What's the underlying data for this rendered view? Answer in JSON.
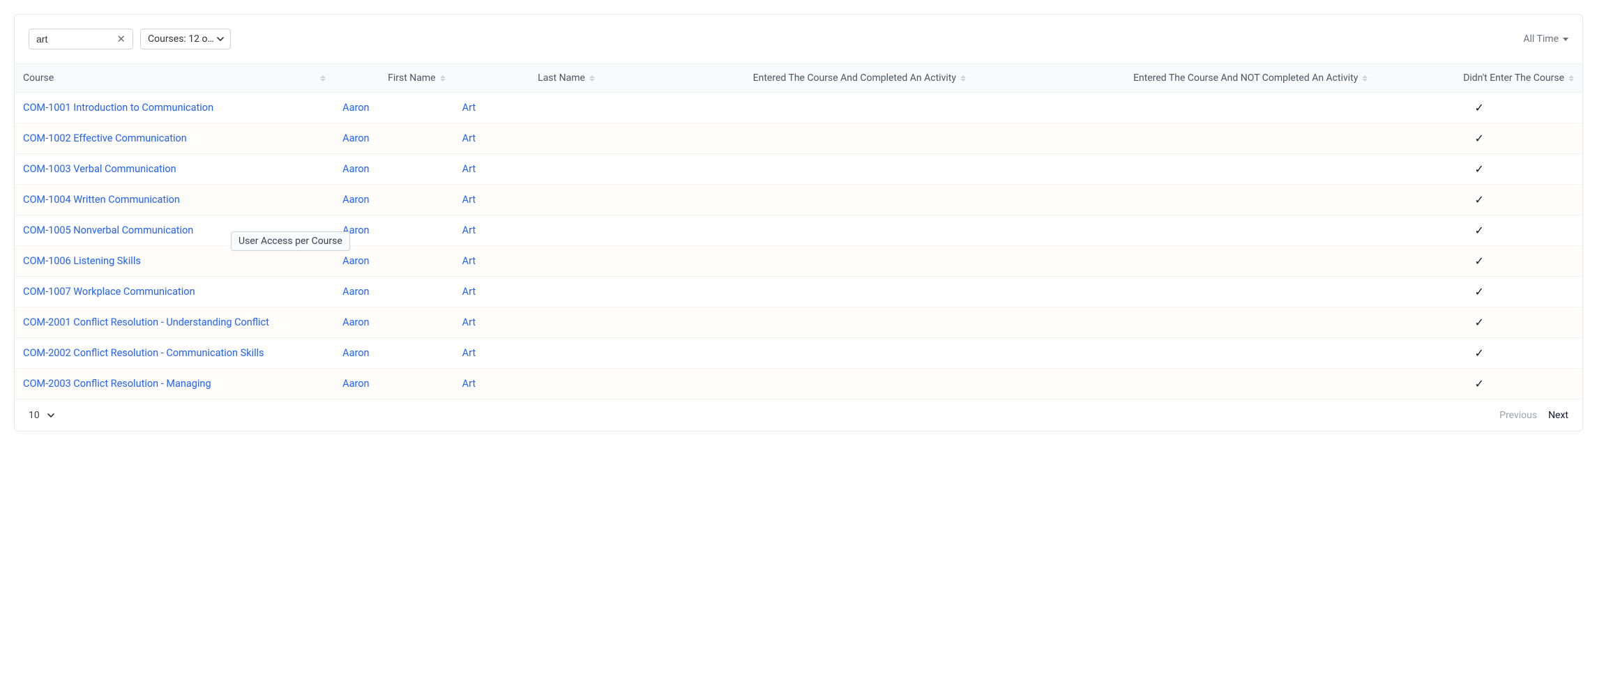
{
  "filters": {
    "search_value": "art",
    "courses_label": "Courses: 12 o…",
    "time_label": "All Time"
  },
  "columns": {
    "course": "Course",
    "first_name": "First Name",
    "last_name": "Last Name",
    "entered_completed": "Entered The Course And Completed An Activity",
    "entered_not_completed": "Entered The Course And NOT Completed An Activity",
    "didnt_enter": "Didn't Enter The Course"
  },
  "rows": [
    {
      "course": "COM-1001 Introduction to Communication",
      "first": "Aaron",
      "last": "Art",
      "c1": "",
      "c2": "",
      "c3": "✓"
    },
    {
      "course": "COM-1002 Effective Communication",
      "first": "Aaron",
      "last": "Art",
      "c1": "",
      "c2": "",
      "c3": "✓"
    },
    {
      "course": "COM-1003 Verbal Communication",
      "first": "Aaron",
      "last": "Art",
      "c1": "",
      "c2": "",
      "c3": "✓"
    },
    {
      "course": "COM-1004 Written Communication",
      "first": "Aaron",
      "last": "Art",
      "c1": "",
      "c2": "",
      "c3": "✓"
    },
    {
      "course": "COM-1005 Nonverbal Communication",
      "first": "Aaron",
      "last": "Art",
      "c1": "",
      "c2": "",
      "c3": "✓"
    },
    {
      "course": "COM-1006 Listening Skills",
      "first": "Aaron",
      "last": "Art",
      "c1": "",
      "c2": "",
      "c3": "✓"
    },
    {
      "course": "COM-1007 Workplace Communication",
      "first": "Aaron",
      "last": "Art",
      "c1": "",
      "c2": "",
      "c3": "✓"
    },
    {
      "course": "COM-2001 Conflict Resolution - Understanding Conflict",
      "first": "Aaron",
      "last": "Art",
      "c1": "",
      "c2": "",
      "c3": "✓"
    },
    {
      "course": "COM-2002 Conflict Resolution - Communication Skills",
      "first": "Aaron",
      "last": "Art",
      "c1": "",
      "c2": "",
      "c3": "✓"
    },
    {
      "course": "COM-2003 Conflict Resolution - Managing",
      "first": "Aaron",
      "last": "Art",
      "c1": "",
      "c2": "",
      "c3": "✓"
    }
  ],
  "tooltip": "User Access per Course",
  "footer": {
    "page_size": "10",
    "previous": "Previous",
    "next": "Next"
  }
}
